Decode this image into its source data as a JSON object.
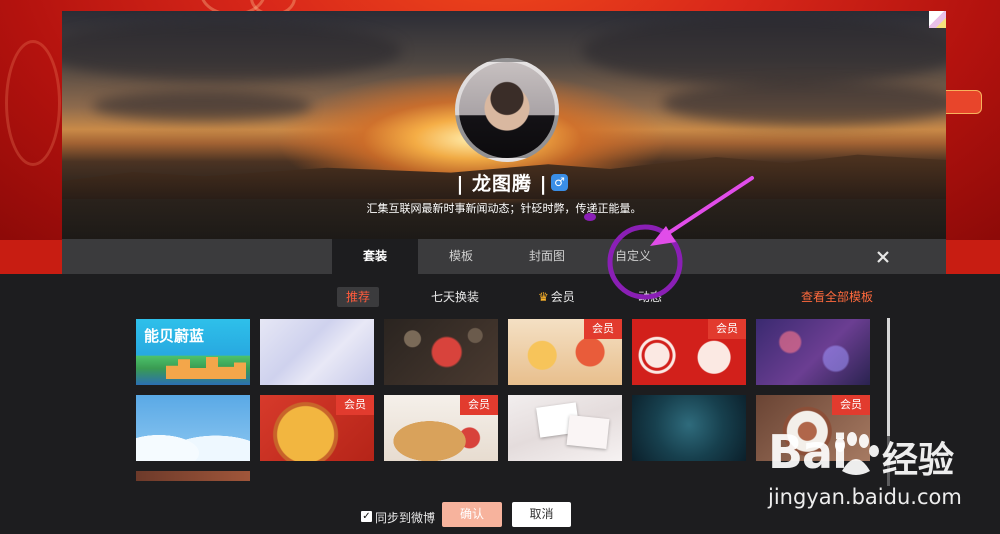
{
  "profile": {
    "name": "| 龙图腾 |",
    "gender_icon": "male-icon",
    "gender_symbol": "♂",
    "description": "汇集互联网最新时事新闻动态；针砭时弊，传递正能量。"
  },
  "tabs": [
    {
      "label": "套装",
      "active": true
    },
    {
      "label": "模板",
      "active": false
    },
    {
      "label": "封面图",
      "active": false
    },
    {
      "label": "自定义",
      "active": false
    }
  ],
  "close_symbol": "✕",
  "filters": {
    "recommend": "推荐",
    "seven_day": "七天换装",
    "member": "会员",
    "dynamic": "动态"
  },
  "view_all": "查看全部模板",
  "templates": [
    {
      "row": 1,
      "col": 1,
      "member": false,
      "theme": "能贝蔚蓝 cartoon city",
      "title": "能贝蔚蓝"
    },
    {
      "row": 1,
      "col": 2,
      "member": false,
      "theme": "lavender geometric"
    },
    {
      "row": 1,
      "col": 3,
      "member": false,
      "theme": "water droplets"
    },
    {
      "row": 1,
      "col": 4,
      "member": true,
      "theme": "festival characters"
    },
    {
      "row": 1,
      "col": 5,
      "member": true,
      "theme": "red sheep papercut"
    },
    {
      "row": 1,
      "col": 6,
      "member": false,
      "theme": "purple bokeh"
    },
    {
      "row": 2,
      "col": 1,
      "member": false,
      "theme": "blue clouds"
    },
    {
      "row": 2,
      "col": 2,
      "member": true,
      "theme": "pizza"
    },
    {
      "row": 2,
      "col": 3,
      "member": true,
      "theme": "pancakes"
    },
    {
      "row": 2,
      "col": 4,
      "member": false,
      "theme": "photo frames"
    },
    {
      "row": 2,
      "col": 5,
      "member": false,
      "theme": "teal night sky"
    },
    {
      "row": 2,
      "col": 6,
      "member": true,
      "theme": "latte heart"
    }
  ],
  "member_badge": "会员",
  "sync": {
    "checked": true,
    "check_mark": "✓",
    "label": "同步到微博"
  },
  "buttons": {
    "confirm": "确认",
    "cancel": "取消"
  },
  "watermark": {
    "brand": "Bai",
    "brand_cn": "经验",
    "url": "jingyan.baidu.com"
  }
}
